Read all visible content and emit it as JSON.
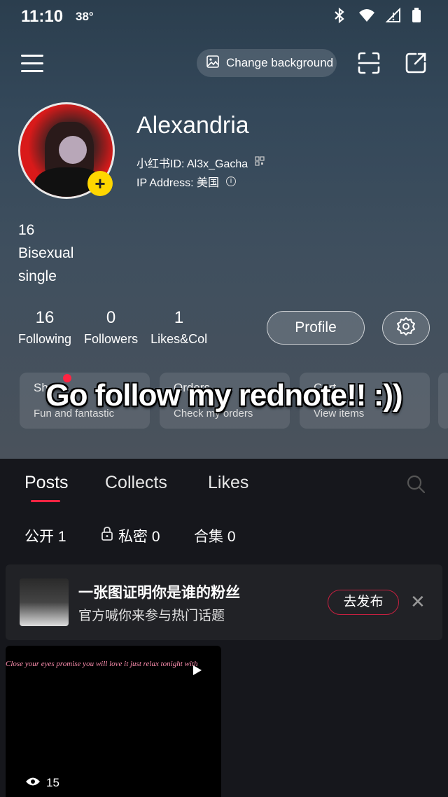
{
  "status": {
    "time": "11:10",
    "temp": "38°"
  },
  "header": {
    "change_background": "Change background"
  },
  "profile": {
    "name": "Alexandria",
    "uid": "小红书ID: Al3x_Gacha",
    "ip": "IP Address: 美国",
    "bio": [
      "16",
      "Bisexual",
      "single"
    ]
  },
  "stats": [
    {
      "num": "16",
      "label": "Following"
    },
    {
      "num": "0",
      "label": "Followers"
    },
    {
      "num": "1",
      "label": "Likes&Col"
    }
  ],
  "buttons": {
    "profile": "Profile"
  },
  "cards": [
    {
      "title": "Sh",
      "sub": "Fun and fantastic"
    },
    {
      "title": "Orders",
      "sub": "Check my orders"
    },
    {
      "title": "Cart",
      "sub": "View items"
    }
  ],
  "overlay": "Go follow my rednote!! :))",
  "tabs": [
    "Posts",
    "Collects",
    "Likes"
  ],
  "subtabs": {
    "public": "公开 1",
    "private": "私密 0",
    "collection": "合集 0"
  },
  "promo": {
    "title": "一张图证明你是谁的粉丝",
    "subtitle": "官方喊你来参与热门话题",
    "button": "去发布"
  },
  "post": {
    "caption": "Close your eyes promise you will love it just relax tonight with",
    "views": "15"
  },
  "colors": {
    "accent": "#ff2442",
    "yellow": "#ffd600"
  }
}
